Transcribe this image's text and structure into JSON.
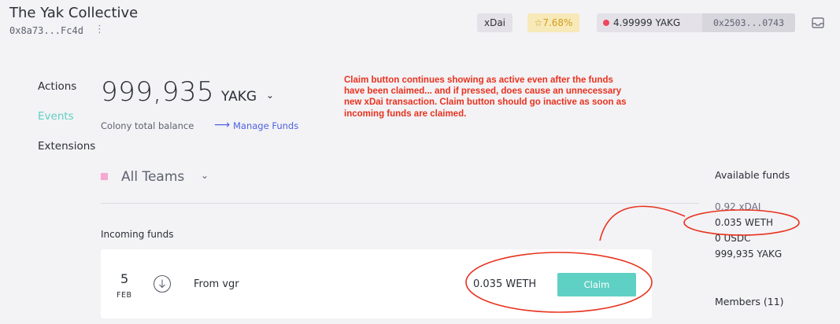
{
  "header": {
    "colony_name": "The Yak Collective",
    "colony_address": "0x8a73...Fc4d",
    "address_menu": "⋮",
    "network": "xDai",
    "reputation": "7.68%",
    "wallet_balance": "4.99999 YAKG",
    "wallet_address": "0x2503...0743"
  },
  "nav": {
    "items": [
      "Actions",
      "Events",
      "Extensions"
    ],
    "active": "Events"
  },
  "balance": {
    "amount": "999,935",
    "token": "YAKG",
    "total_label": "Colony total balance",
    "manage_funds": "Manage Funds"
  },
  "annotation": {
    "text": "Claim button continues showing as active even after the funds have been claimed... and if pressed, does cause an unnecessary new xDai transaction. Claim button should go inactive as soon as incoming funds are claimed."
  },
  "teams": {
    "selected": "All Teams"
  },
  "incoming": {
    "label": "Incoming funds",
    "transfers": [
      {
        "day": "5",
        "month": "FEB",
        "from": "From vgr",
        "amount": "0.035 WETH",
        "action": "Claim"
      }
    ]
  },
  "available": {
    "title": "Available funds",
    "items": [
      "0.92 xDAI",
      "0.035 WETH",
      "0 USDC",
      "999,935 YAKG"
    ]
  },
  "members": {
    "title": "Members (11)"
  },
  "colors": {
    "accent": "#5fd0c4",
    "link": "#4d63e0",
    "annotation": "#e8321e",
    "status_dot": "#f0465c"
  },
  "icons": {
    "reputation": "star-icon",
    "inbox": "inbox-icon",
    "transfer": "arrow-down-circle-icon",
    "manage": "arrow-right-icon"
  }
}
